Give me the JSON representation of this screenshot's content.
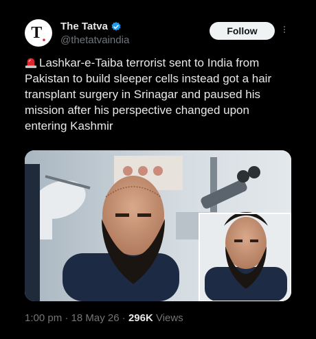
{
  "account": {
    "name": "The Tatva",
    "handle": "@thetatvaindia",
    "avatar_letter": "T",
    "verified_icon": "verified-badge-icon"
  },
  "actions": {
    "follow_label": "Follow",
    "more_icon": "more-vertical-icon"
  },
  "tweet": {
    "emoji_icon": "police-siren-icon",
    "text": "Lashkar-e-Taiba terrorist sent to India from Pakistan to build sleeper cells instead got a hair transplant surgery in Srinagar and paused his mission after his perspective changed upon entering Kashmir"
  },
  "media": {
    "description_icon": "photo-image"
  },
  "meta": {
    "time": "1:00 pm",
    "separator": "·",
    "date": "18 May 26",
    "views_count": "296K",
    "views_label": "Views"
  },
  "colors": {
    "background": "#000000",
    "text": "#e7e9ea",
    "muted": "#71767b",
    "verified": "#1d9bf0",
    "follow_bg": "#eff3f4"
  }
}
